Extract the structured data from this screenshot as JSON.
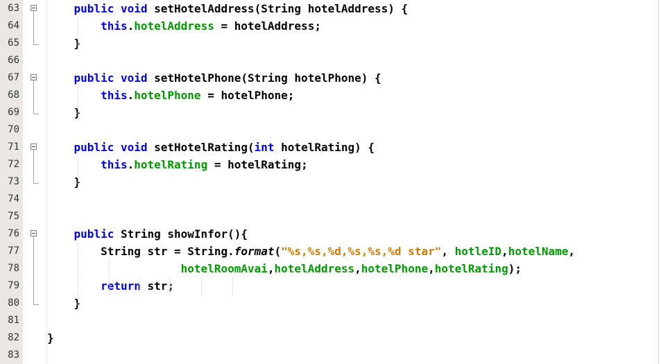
{
  "editor": {
    "lines": [
      {
        "num": "63",
        "indent": "    ",
        "tokens": [
          {
            "t": "public",
            "c": "kw"
          },
          {
            "t": " "
          },
          {
            "t": "void",
            "c": "kw"
          },
          {
            "t": " setHotelAddress(String hotelAddress) {"
          }
        ]
      },
      {
        "num": "64",
        "indent": "        ",
        "tokens": [
          {
            "t": "this",
            "c": "kw"
          },
          {
            "t": "."
          },
          {
            "t": "hotelAddress",
            "c": "fld"
          },
          {
            "t": " = hotelAddress;"
          }
        ]
      },
      {
        "num": "65",
        "indent": "    ",
        "tokens": [
          {
            "t": "}"
          }
        ]
      },
      {
        "num": "66",
        "indent": "",
        "tokens": []
      },
      {
        "num": "67",
        "indent": "    ",
        "tokens": [
          {
            "t": "public",
            "c": "kw"
          },
          {
            "t": " "
          },
          {
            "t": "void",
            "c": "kw"
          },
          {
            "t": " setHotelPhone(String hotelPhone) {"
          }
        ]
      },
      {
        "num": "68",
        "indent": "        ",
        "tokens": [
          {
            "t": "this",
            "c": "kw"
          },
          {
            "t": "."
          },
          {
            "t": "hotelPhone",
            "c": "fld"
          },
          {
            "t": " = hotelPhone;"
          }
        ]
      },
      {
        "num": "69",
        "indent": "    ",
        "tokens": [
          {
            "t": "}"
          }
        ]
      },
      {
        "num": "70",
        "indent": "",
        "tokens": []
      },
      {
        "num": "71",
        "indent": "    ",
        "tokens": [
          {
            "t": "public",
            "c": "kw"
          },
          {
            "t": " "
          },
          {
            "t": "void",
            "c": "kw"
          },
          {
            "t": " setHotelRating("
          },
          {
            "t": "int",
            "c": "kw"
          },
          {
            "t": " hotelRating) {"
          }
        ]
      },
      {
        "num": "72",
        "indent": "        ",
        "tokens": [
          {
            "t": "this",
            "c": "kw"
          },
          {
            "t": "."
          },
          {
            "t": "hotelRating",
            "c": "fld"
          },
          {
            "t": " = hotelRating;"
          }
        ]
      },
      {
        "num": "73",
        "indent": "    ",
        "tokens": [
          {
            "t": "}"
          }
        ]
      },
      {
        "num": "74",
        "indent": "",
        "tokens": []
      },
      {
        "num": "75",
        "indent": "",
        "tokens": []
      },
      {
        "num": "76",
        "indent": "    ",
        "tokens": [
          {
            "t": "public",
            "c": "kw"
          },
          {
            "t": " String showInfor(){"
          }
        ]
      },
      {
        "num": "77",
        "indent": "        ",
        "tokens": [
          {
            "t": "String str = String."
          },
          {
            "t": "format",
            "c": "it"
          },
          {
            "t": "("
          },
          {
            "t": "\"%s,%s,%d,%s,%s,%d star\"",
            "c": "str"
          },
          {
            "t": ", "
          },
          {
            "t": "hotleID",
            "c": "fld"
          },
          {
            "t": ","
          },
          {
            "t": "hotelName",
            "c": "fld"
          },
          {
            "t": ","
          }
        ]
      },
      {
        "num": "78",
        "indent": "                    ",
        "tokens": [
          {
            "t": "hotelRoomAvai",
            "c": "fld"
          },
          {
            "t": ","
          },
          {
            "t": "hotelAddress",
            "c": "fld"
          },
          {
            "t": ","
          },
          {
            "t": "hotelPhone",
            "c": "fld"
          },
          {
            "t": ","
          },
          {
            "t": "hotelRating",
            "c": "fld"
          },
          {
            "t": ");"
          }
        ]
      },
      {
        "num": "79",
        "indent": "        ",
        "tokens": [
          {
            "t": "return",
            "c": "kw"
          },
          {
            "t": " str;"
          }
        ]
      },
      {
        "num": "80",
        "indent": "    ",
        "tokens": [
          {
            "t": "}"
          }
        ]
      },
      {
        "num": "81",
        "indent": "",
        "tokens": []
      },
      {
        "num": "82",
        "indent": "",
        "tokens": [
          {
            "t": "}"
          }
        ]
      },
      {
        "num": "83",
        "indent": "",
        "tokens": []
      }
    ]
  }
}
